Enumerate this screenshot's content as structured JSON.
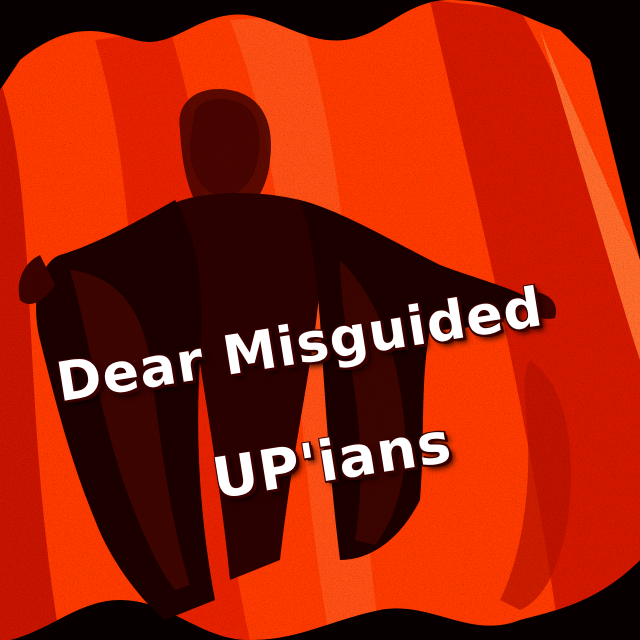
{
  "caption": {
    "line1": "Dear Misguided",
    "line2": "UP'ians"
  },
  "image": {
    "subject": "statue-with-outstretched-cloak",
    "palette": {
      "background": "#080000",
      "panel": "#ff3300",
      "stripe_dark": "#c41000",
      "stripe_light": "#ff5a1f",
      "figure": "#1a0000",
      "caption_text": "#ffffff",
      "caption_shadow": "#3a0000"
    }
  }
}
